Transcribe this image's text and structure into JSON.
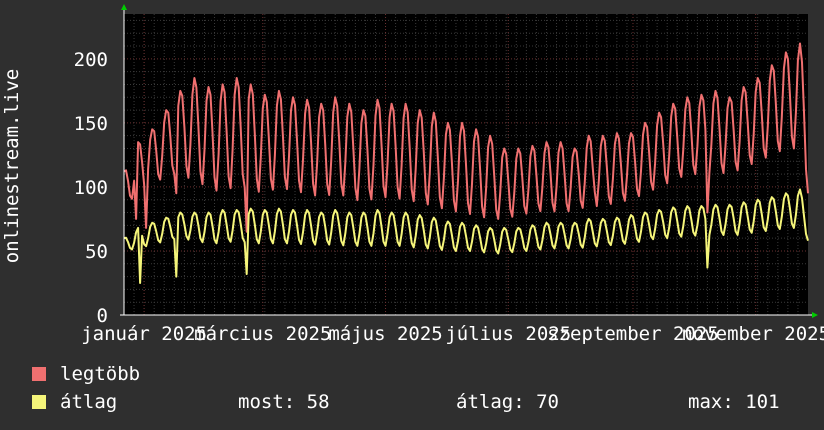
{
  "colors": {
    "background": "#2f2f2f",
    "plot_background": "#000000",
    "grid_minor": "#3a3a3a",
    "grid_major": "#6b3030",
    "axis": "#ffffff",
    "arrow": "#00cc00",
    "series_max": "#f07070",
    "series_avg": "#f5f57a"
  },
  "legend": {
    "max_label": "legtöbb",
    "avg_label": "átlag",
    "most_label": "most: 58",
    "atlag_label": "átlag: 70",
    "max_stat_label": "max: 101"
  },
  "chart_data": {
    "type": "line",
    "ylabel": "onlinestream.live",
    "ylim": [
      0,
      235
    ],
    "yticks": [
      0,
      50,
      100,
      150,
      200
    ],
    "xlim": [
      0,
      340
    ],
    "xticks": [
      {
        "x": 10,
        "label": "január 2025"
      },
      {
        "x": 69,
        "label": "március 2025"
      },
      {
        "x": 130,
        "label": "május 2025"
      },
      {
        "x": 191,
        "label": "július 2025"
      },
      {
        "x": 253,
        "label": "szeptember 2025"
      },
      {
        "x": 314,
        "label": "november 2025"
      }
    ],
    "grid": true,
    "series": [
      {
        "name": "legtöbb",
        "color": "#f07070",
        "x": [
          0,
          7,
          14,
          21,
          28,
          35,
          42,
          49,
          56,
          63,
          70,
          77,
          84,
          91,
          98,
          105,
          112,
          119,
          126,
          133,
          140,
          147,
          154,
          161,
          168,
          175,
          182,
          189,
          196,
          203,
          210,
          217,
          224,
          231,
          238,
          245,
          252,
          259,
          266,
          273,
          280,
          287,
          294,
          301,
          308,
          315,
          322,
          329,
          336,
          340
        ],
        "hi": [
          112,
          135,
          145,
          160,
          175,
          185,
          178,
          180,
          185,
          180,
          172,
          175,
          170,
          168,
          165,
          170,
          165,
          160,
          168,
          165,
          165,
          160,
          158,
          150,
          150,
          145,
          140,
          130,
          130,
          132,
          135,
          135,
          130,
          140,
          140,
          142,
          142,
          150,
          158,
          165,
          170,
          172,
          175,
          170,
          178,
          185,
          195,
          205,
          212,
          180
        ],
        "lo": [
          85,
          95,
          100,
          110,
          110,
          105,
          100,
          95,
          102,
          98,
          95,
          100,
          97,
          95,
          92,
          95,
          92,
          88,
          92,
          92,
          90,
          88,
          85,
          82,
          80,
          78,
          75,
          75,
          78,
          80,
          82,
          80,
          82,
          85,
          85,
          88,
          90,
          95,
          100,
          105,
          110,
          110,
          112,
          110,
          115,
          120,
          125,
          130,
          130,
          95
        ]
      },
      {
        "name": "átlag",
        "color": "#f5f57a",
        "x": [
          0,
          7,
          14,
          21,
          28,
          35,
          42,
          49,
          56,
          63,
          70,
          77,
          84,
          91,
          98,
          105,
          112,
          119,
          126,
          133,
          140,
          147,
          154,
          161,
          168,
          175,
          182,
          189,
          196,
          203,
          210,
          217,
          224,
          231,
          238,
          245,
          252,
          259,
          266,
          273,
          280,
          287,
          294,
          301,
          308,
          315,
          322,
          329,
          336,
          340
        ],
        "hi": [
          60,
          68,
          72,
          76,
          80,
          80,
          80,
          82,
          82,
          83,
          82,
          83,
          82,
          82,
          80,
          82,
          80,
          80,
          82,
          80,
          80,
          78,
          76,
          73,
          72,
          70,
          68,
          68,
          68,
          70,
          72,
          72,
          72,
          75,
          75,
          76,
          78,
          80,
          82,
          84,
          85,
          85,
          86,
          86,
          88,
          90,
          92,
          95,
          98,
          80
        ],
        "lo": [
          50,
          52,
          55,
          58,
          60,
          58,
          56,
          56,
          58,
          56,
          56,
          56,
          56,
          55,
          55,
          55,
          54,
          54,
          54,
          54,
          54,
          52,
          52,
          50,
          50,
          50,
          48,
          48,
          50,
          50,
          52,
          52,
          52,
          53,
          54,
          55,
          56,
          58,
          60,
          60,
          62,
          62,
          63,
          62,
          63,
          65,
          66,
          68,
          68,
          58
        ]
      }
    ]
  }
}
